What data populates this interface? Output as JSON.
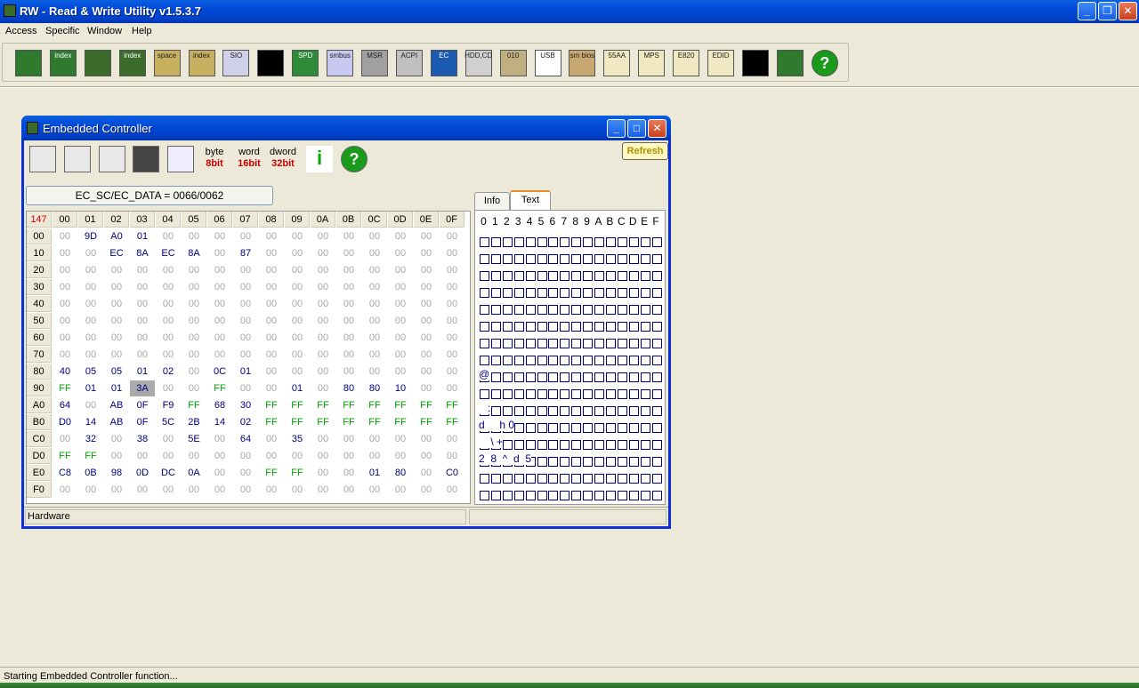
{
  "app": {
    "title": "RW - Read & Write Utility v1.5.3.7"
  },
  "menu": [
    "Access",
    "Specific",
    "Window",
    "Help"
  ],
  "toolbar": [
    {
      "icon": "pci-icon",
      "label": ""
    },
    {
      "icon": "pci-index-icon",
      "label": "index"
    },
    {
      "icon": "memory-icon",
      "label": ""
    },
    {
      "icon": "memory-index-icon",
      "label": "index"
    },
    {
      "icon": "io-space-icon",
      "label": "space"
    },
    {
      "icon": "io-index-icon",
      "label": "index"
    },
    {
      "icon": "sio-icon",
      "label": "SIO"
    },
    {
      "icon": "oscilloscope-icon",
      "label": ""
    },
    {
      "icon": "spd-icon",
      "label": "SPD"
    },
    {
      "icon": "smbus-icon",
      "label": "smbus"
    },
    {
      "icon": "msr-icon",
      "label": "MSR"
    },
    {
      "icon": "acpi-icon",
      "label": "ACPI"
    },
    {
      "icon": "ec-icon",
      "label": "EC"
    },
    {
      "icon": "hdd-cd-icon",
      "label": "HDD,CD"
    },
    {
      "icon": "hex-010-icon",
      "label": "010"
    },
    {
      "icon": "usb-icon",
      "label": "USB"
    },
    {
      "icon": "smbios-icon",
      "label": "sm bios"
    },
    {
      "icon": "55aa-icon",
      "label": "55AA"
    },
    {
      "icon": "mps-icon",
      "label": "MPS"
    },
    {
      "icon": "e820-icon",
      "label": "E820"
    },
    {
      "icon": "edid-icon",
      "label": "EDID"
    },
    {
      "icon": "command-prompt-icon",
      "label": ""
    },
    {
      "icon": "plugin-icon",
      "label": ""
    },
    {
      "icon": "help-icon",
      "label": "?"
    }
  ],
  "ec": {
    "title": "Embedded Controller",
    "refresh": "Refresh",
    "port": "EC_SC/EC_DATA = 0066/0062",
    "width_buttons": [
      {
        "top": "byte",
        "bottom": "8bit"
      },
      {
        "top": "word",
        "bottom": "16bit"
      },
      {
        "top": "dword",
        "bottom": "32bit"
      }
    ],
    "corner": "147",
    "cols": [
      "00",
      "01",
      "02",
      "03",
      "04",
      "05",
      "06",
      "07",
      "08",
      "09",
      "0A",
      "0B",
      "0C",
      "0D",
      "0E",
      "0F"
    ],
    "rows": [
      {
        "addr": "00",
        "vals": [
          "00",
          "9D",
          "A0",
          "01",
          "00",
          "00",
          "00",
          "00",
          "00",
          "00",
          "00",
          "00",
          "00",
          "00",
          "00",
          "00"
        ]
      },
      {
        "addr": "10",
        "vals": [
          "00",
          "00",
          "EC",
          "8A",
          "EC",
          "8A",
          "00",
          "87",
          "00",
          "00",
          "00",
          "00",
          "00",
          "00",
          "00",
          "00"
        ]
      },
      {
        "addr": "20",
        "vals": [
          "00",
          "00",
          "00",
          "00",
          "00",
          "00",
          "00",
          "00",
          "00",
          "00",
          "00",
          "00",
          "00",
          "00",
          "00",
          "00"
        ]
      },
      {
        "addr": "30",
        "vals": [
          "00",
          "00",
          "00",
          "00",
          "00",
          "00",
          "00",
          "00",
          "00",
          "00",
          "00",
          "00",
          "00",
          "00",
          "00",
          "00"
        ]
      },
      {
        "addr": "40",
        "vals": [
          "00",
          "00",
          "00",
          "00",
          "00",
          "00",
          "00",
          "00",
          "00",
          "00",
          "00",
          "00",
          "00",
          "00",
          "00",
          "00"
        ]
      },
      {
        "addr": "50",
        "vals": [
          "00",
          "00",
          "00",
          "00",
          "00",
          "00",
          "00",
          "00",
          "00",
          "00",
          "00",
          "00",
          "00",
          "00",
          "00",
          "00"
        ]
      },
      {
        "addr": "60",
        "vals": [
          "00",
          "00",
          "00",
          "00",
          "00",
          "00",
          "00",
          "00",
          "00",
          "00",
          "00",
          "00",
          "00",
          "00",
          "00",
          "00"
        ]
      },
      {
        "addr": "70",
        "vals": [
          "00",
          "00",
          "00",
          "00",
          "00",
          "00",
          "00",
          "00",
          "00",
          "00",
          "00",
          "00",
          "00",
          "00",
          "00",
          "00"
        ]
      },
      {
        "addr": "80",
        "vals": [
          "40",
          "05",
          "05",
          "01",
          "02",
          "00",
          "0C",
          "01",
          "00",
          "00",
          "00",
          "00",
          "00",
          "00",
          "00",
          "00"
        ]
      },
      {
        "addr": "90",
        "vals": [
          "FF",
          "01",
          "01",
          "3A",
          "00",
          "00",
          "FF",
          "00",
          "00",
          "01",
          "00",
          "80",
          "80",
          "10",
          "00",
          "00"
        ]
      },
      {
        "addr": "A0",
        "vals": [
          "64",
          "00",
          "AB",
          "0F",
          "F9",
          "FF",
          "68",
          "30",
          "FF",
          "FF",
          "FF",
          "FF",
          "FF",
          "FF",
          "FF",
          "FF"
        ]
      },
      {
        "addr": "B0",
        "vals": [
          "D0",
          "14",
          "AB",
          "0F",
          "5C",
          "2B",
          "14",
          "02",
          "FF",
          "FF",
          "FF",
          "FF",
          "FF",
          "FF",
          "FF",
          "FF"
        ]
      },
      {
        "addr": "C0",
        "vals": [
          "00",
          "32",
          "00",
          "38",
          "00",
          "5E",
          "00",
          "64",
          "00",
          "35",
          "00",
          "00",
          "00",
          "00",
          "00",
          "00"
        ]
      },
      {
        "addr": "D0",
        "vals": [
          "FF",
          "FF",
          "00",
          "00",
          "00",
          "00",
          "00",
          "00",
          "00",
          "00",
          "00",
          "00",
          "00",
          "00",
          "00",
          "00"
        ]
      },
      {
        "addr": "E0",
        "vals": [
          "C8",
          "0B",
          "98",
          "0D",
          "DC",
          "0A",
          "00",
          "00",
          "FF",
          "FF",
          "00",
          "00",
          "01",
          "80",
          "00",
          "C0"
        ]
      },
      {
        "addr": "F0",
        "vals": [
          "00",
          "00",
          "00",
          "00",
          "00",
          "00",
          "00",
          "00",
          "00",
          "00",
          "00",
          "00",
          "00",
          "00",
          "00",
          "00"
        ]
      }
    ],
    "tabs": [
      "Info",
      "Text"
    ],
    "active_tab": "Text",
    "text_header": [
      "0",
      "1",
      "2",
      "3",
      "4",
      "5",
      "6",
      "7",
      "8",
      "9",
      "A",
      "B",
      "C",
      "D",
      "E",
      "F"
    ],
    "text_rows": [
      "",
      "",
      "",
      "",
      "",
      "",
      "",
      "",
      "@",
      "",
      "   :",
      "d     h 0",
      "    \\ +",
      "2  8  ^  d  5",
      "",
      ""
    ],
    "status": "Hardware"
  },
  "statusbar": "Starting Embedded Controller function..."
}
